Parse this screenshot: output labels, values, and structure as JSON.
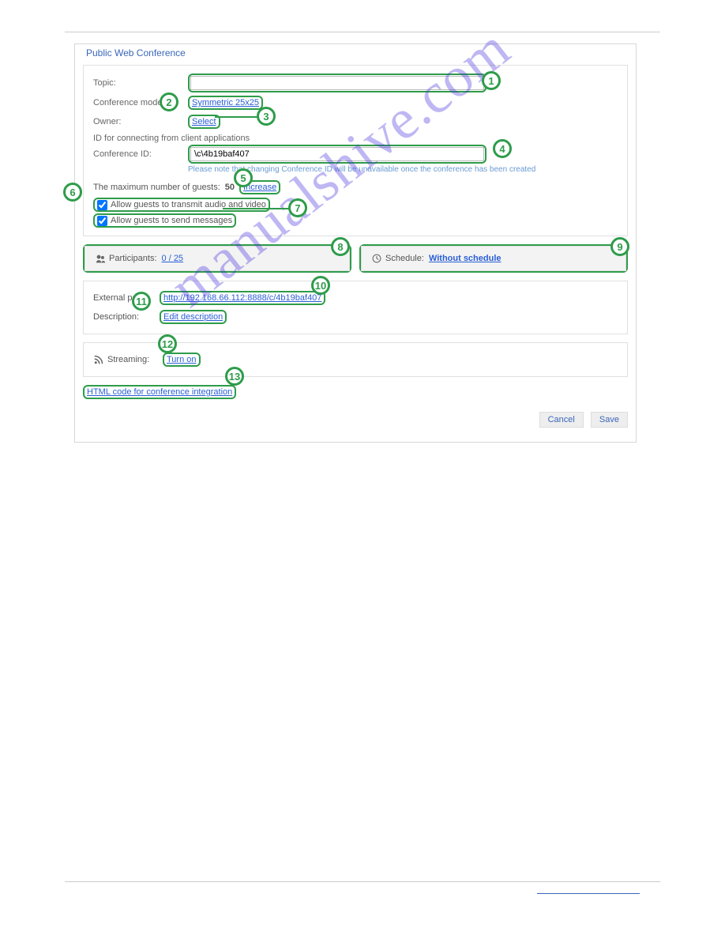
{
  "panel_title": "Public Web Conference",
  "labels": {
    "topic": "Topic:",
    "mode": "Conference mode:",
    "owner": "Owner:",
    "id_hint": "ID for connecting from client applications",
    "conf_id": "Conference ID:",
    "note": "Please note that changing Conference ID will be unavailable once the conference has been created",
    "max_guests": "The maximum number of guests:",
    "allow_av": "Allow guests to transmit audio and video",
    "allow_msg": "Allow guests to send messages",
    "participants": "Participants:",
    "schedule": "Schedule:",
    "ext_page": "External page:",
    "description": "Description:",
    "streaming": "Streaming:"
  },
  "values": {
    "mode_link": "Symmetric 25x25",
    "owner_link": "Select",
    "conf_id_value": "\\c\\4b19baf407",
    "max_guests_value": "50",
    "increase_link": "Increase",
    "participants_link": "0 / 25",
    "schedule_link": "Without schedule",
    "ext_page_link": "http://192.168.66.112:8888/c/4b19baf407",
    "edit_desc_link": "Edit description",
    "streaming_link": "Turn on",
    "html_code_link": "HTML code for conference integration"
  },
  "buttons": {
    "cancel": "Cancel",
    "save": "Save"
  },
  "watermark": "manualshive.com",
  "callouts": {
    "1": "1",
    "2": "2",
    "3": "3",
    "4": "4",
    "5": "5",
    "6": "6",
    "7": "7",
    "8": "8",
    "9": "9",
    "10": "10",
    "11": "11",
    "12": "12",
    "13": "13"
  }
}
